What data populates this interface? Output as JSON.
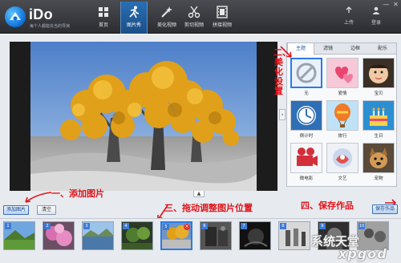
{
  "app": {
    "name": "iDo",
    "tagline": "每个人都能充当的导演"
  },
  "nav": [
    {
      "label": "首页",
      "icon": "home-icon",
      "active": false
    },
    {
      "label": "图片秀",
      "icon": "run-figure-icon",
      "active": true
    },
    {
      "label": "美化视频",
      "icon": "magic-wand-icon",
      "active": false
    },
    {
      "label": "剪切视频",
      "icon": "scissors-icon",
      "active": false
    },
    {
      "label": "拼接视频",
      "icon": "film-strip-icon",
      "active": false
    }
  ],
  "toolbar_right": {
    "upload_label": "上传",
    "login_label": "登录"
  },
  "window_controls": {
    "minimize": "—",
    "close": "✕"
  },
  "effects_panel": {
    "tabs": [
      "主题",
      "滤镜",
      "边框",
      "配乐"
    ],
    "active_tab": 0,
    "items": [
      {
        "label": "无",
        "icon": "no-effect-icon",
        "selected": true
      },
      {
        "label": "爱情",
        "icon": "love-theme-icon",
        "selected": false
      },
      {
        "label": "宝贝",
        "icon": "baby-theme-icon",
        "selected": false
      },
      {
        "label": "倒计时",
        "icon": "countdown-theme-icon",
        "selected": false
      },
      {
        "label": "旅行",
        "icon": "balloon-theme-icon",
        "selected": false
      },
      {
        "label": "生日",
        "icon": "birthday-theme-icon",
        "selected": false
      },
      {
        "label": "微电影",
        "icon": "film-camera-theme-icon",
        "selected": false
      },
      {
        "label": "文艺",
        "icon": "art-theme-icon",
        "selected": false
      },
      {
        "label": "宠物",
        "icon": "pet-theme-icon",
        "selected": false
      }
    ]
  },
  "buttons": {
    "add_image": "添加图片",
    "clear": "清空",
    "save_work": "保存作品"
  },
  "thumbnails": [
    {
      "num": "1"
    },
    {
      "num": "2"
    },
    {
      "num": "3"
    },
    {
      "num": "4"
    },
    {
      "num": "5",
      "selected": true
    },
    {
      "num": "6"
    },
    {
      "num": "7"
    },
    {
      "num": "8"
    },
    {
      "num": "9"
    },
    {
      "num": "10"
    }
  ],
  "annotations": {
    "beautify": "二、美化设置",
    "add_image": "一、添加图片",
    "drag_reorder": "三、拖动调整图片位置",
    "save_work": "四、保存作品"
  },
  "watermark": {
    "line1": "系统天堂",
    "line2": "xpgod"
  },
  "colors": {
    "accent": "#2a7be4",
    "annotation": "#e0141b",
    "titlebar": "#3a3b40"
  }
}
